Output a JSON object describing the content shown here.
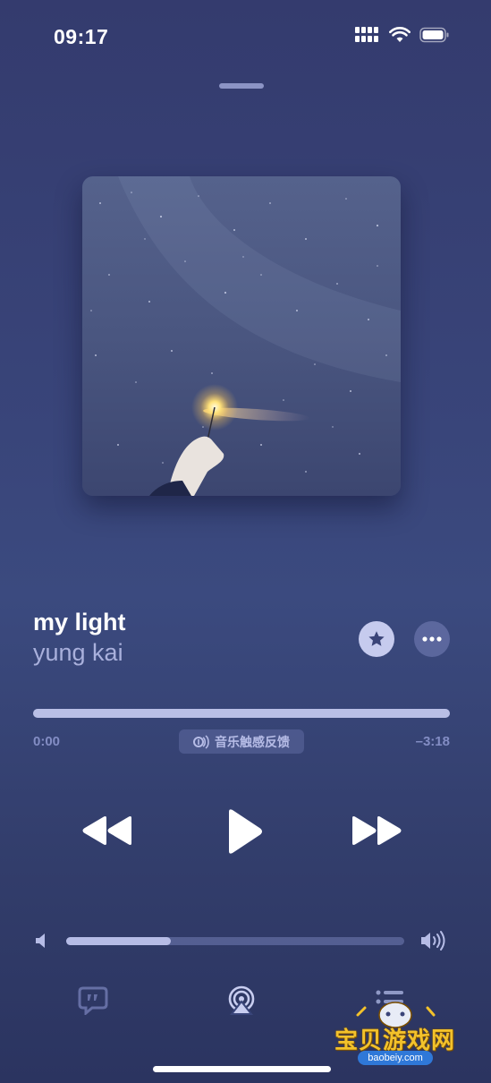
{
  "status_bar": {
    "time": "09:17",
    "icons": [
      "signal-icon",
      "wifi-icon",
      "battery-icon"
    ]
  },
  "now_playing": {
    "title": "my light",
    "artist": "yung kai",
    "artwork": "night-sky-sparkler-artwork",
    "favorited": true
  },
  "progress": {
    "elapsed": "0:00",
    "remaining": "–3:18",
    "fraction": 1.0,
    "haptics_label": "音乐触感反馈"
  },
  "controls": [
    "rewind",
    "play",
    "fast-forward"
  ],
  "volume": {
    "level": 0.31
  },
  "toolbar": [
    "lyrics",
    "airplay",
    "queue"
  ],
  "watermark": {
    "text": "宝贝游戏网",
    "url": "baobeiy.com"
  },
  "colors": {
    "background": "#39457a",
    "accent": "#b9bfe6",
    "secondary_text": "#a9b0dc"
  }
}
